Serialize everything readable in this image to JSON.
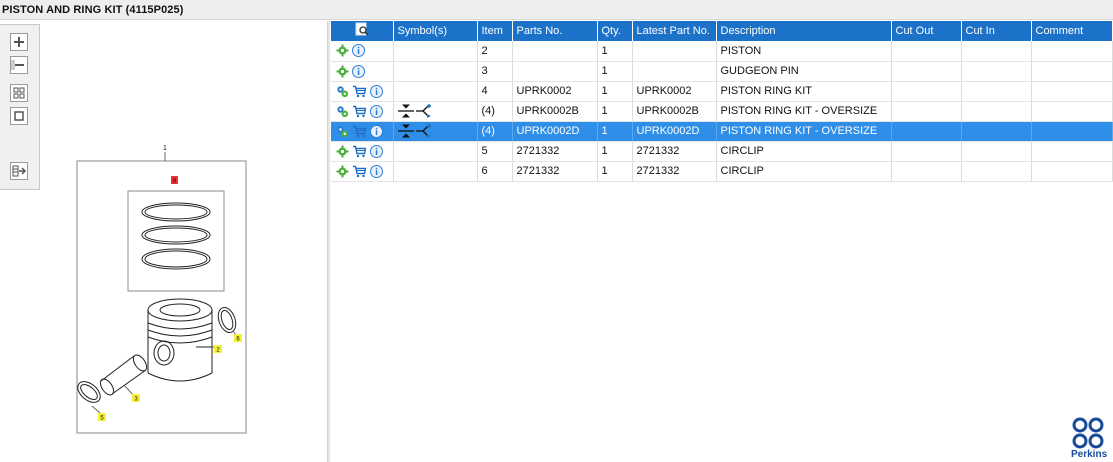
{
  "window": {
    "title": "PISTON AND RING KIT (4115P025)"
  },
  "toolbar": {
    "buttons": [
      "zoom-in",
      "zoom-out",
      "fit-all",
      "fit-window",
      "show-hotspots"
    ]
  },
  "drawing": {
    "callouts": [
      "1",
      "8",
      "2",
      "6",
      "3",
      "5"
    ]
  },
  "grid": {
    "columns": [
      "",
      "Symbol(s)",
      "Item",
      "Parts No.",
      "Qty.",
      "Latest Part No.",
      "Description",
      "Cut Out",
      "Cut In",
      "Comment"
    ],
    "rows": [
      {
        "icons": [
          "gear",
          "info"
        ],
        "symbols": [],
        "item": "2",
        "part_no": "",
        "qty": "1",
        "latest_part_no": "",
        "description": "PISTON",
        "cut_out": "",
        "cut_in": "",
        "comment": "",
        "selected": false
      },
      {
        "icons": [
          "gear",
          "info"
        ],
        "symbols": [],
        "item": "3",
        "part_no": "",
        "qty": "1",
        "latest_part_no": "",
        "description": "GUDGEON PIN",
        "cut_out": "",
        "cut_in": "",
        "comment": "",
        "selected": false
      },
      {
        "icons": [
          "gears",
          "cart",
          "info"
        ],
        "symbols": [],
        "item": "4",
        "part_no": "UPRK0002",
        "qty": "1",
        "latest_part_no": "UPRK0002",
        "description": "PISTON RING KIT",
        "cut_out": "",
        "cut_in": "",
        "comment": "",
        "selected": false
      },
      {
        "icons": [
          "gears",
          "cart",
          "info"
        ],
        "symbols": [
          "compress",
          "branch"
        ],
        "item": "(4)",
        "part_no": "UPRK0002B",
        "qty": "1",
        "latest_part_no": "UPRK0002B",
        "description": "PISTON RING KIT - OVERSIZE",
        "cut_out": "",
        "cut_in": "",
        "comment": "",
        "selected": false
      },
      {
        "icons": [
          "gears",
          "cart",
          "info"
        ],
        "symbols": [
          "compress",
          "branch"
        ],
        "item": "(4)",
        "part_no": "UPRK0002D",
        "qty": "1",
        "latest_part_no": "UPRK0002D",
        "description": "PISTON RING KIT - OVERSIZE",
        "cut_out": "",
        "cut_in": "",
        "comment": "",
        "selected": true
      },
      {
        "icons": [
          "gear",
          "cart",
          "info"
        ],
        "symbols": [],
        "item": "5",
        "part_no": "2721332",
        "qty": "1",
        "latest_part_no": "2721332",
        "description": "CIRCLIP",
        "cut_out": "",
        "cut_in": "",
        "comment": "",
        "selected": false
      },
      {
        "icons": [
          "gear",
          "cart",
          "info"
        ],
        "symbols": [],
        "item": "6",
        "part_no": "2721332",
        "qty": "1",
        "latest_part_no": "2721332",
        "description": "CIRCLIP",
        "cut_out": "",
        "cut_in": "",
        "comment": "",
        "selected": false
      }
    ]
  },
  "brand": {
    "name": "Perkins"
  },
  "colors": {
    "header": "#1c72c9",
    "selected_row": "#2f8fe8",
    "gear": "#4caf3c",
    "info": "#2a7fd4",
    "cart": "#1f6fc4",
    "logo": "#1a4a9a"
  }
}
